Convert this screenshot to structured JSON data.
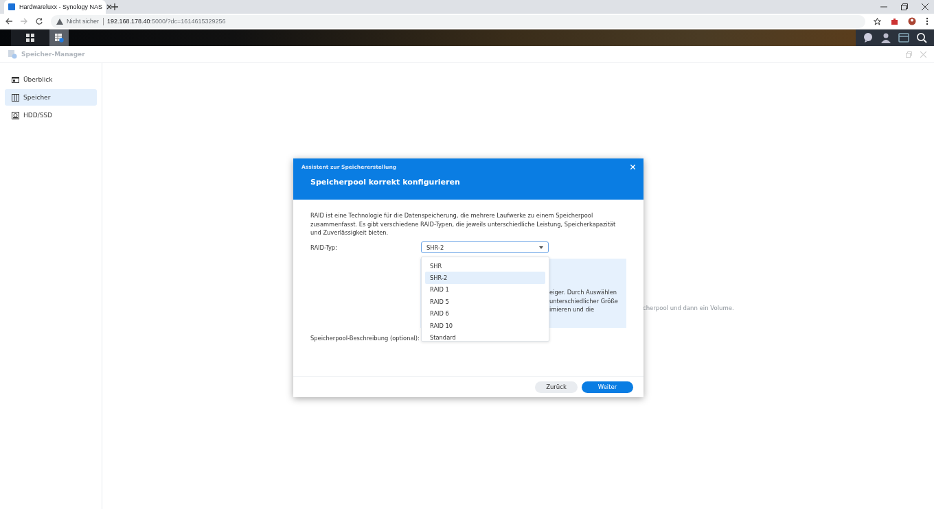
{
  "browser": {
    "tab_title": "Hardwareluxx - Synology NAS",
    "security": "Nicht sicher",
    "url_host": "192.168.178.40",
    "url_rest": ":5000/?dc=1614615329256"
  },
  "app": {
    "title": "Speicher-Manager"
  },
  "sidebar": {
    "items": [
      {
        "label": "Überblick",
        "selected": false
      },
      {
        "label": "Speicher",
        "selected": true
      },
      {
        "label": "HDD/SSD",
        "selected": false
      }
    ]
  },
  "background_text": "cherpool und dann ein Volume.",
  "dialog": {
    "header": "Assistent zur Speichererstellung",
    "title": "Speicherpool korrekt konfigurieren",
    "description": "RAID ist eine Technologie für die Datenspeicherung, die mehrere Laufwerke zu einem Speicherpool zusammenfasst. Es gibt verschiedene RAID-Typen, die jeweils unterschiedliche Leistung, Speicherkapazität und Zuverlässigkeit bieten.",
    "raid_label": "RAID-Typ:",
    "raid_value": "SHR-2",
    "options": [
      {
        "label": "SHR",
        "selected": false
      },
      {
        "label": "SHR-2",
        "selected": true
      },
      {
        "label": "RAID 1",
        "selected": false
      },
      {
        "label": "RAID 5",
        "selected": false
      },
      {
        "label": "RAID 6",
        "selected": false
      },
      {
        "label": "RAID 10",
        "selected": false
      },
      {
        "label": "Standard",
        "selected": false
      }
    ],
    "info_lines": [
      "eiger. Durch Auswählen",
      "unterschiedlicher Größe",
      "imieren und die"
    ],
    "description_label": "Speicherpool-Beschreibung (optional):",
    "buttons": [
      {
        "label": "Zurück",
        "kind": "secondary"
      },
      {
        "label": "Weiter",
        "kind": "primary"
      }
    ]
  }
}
